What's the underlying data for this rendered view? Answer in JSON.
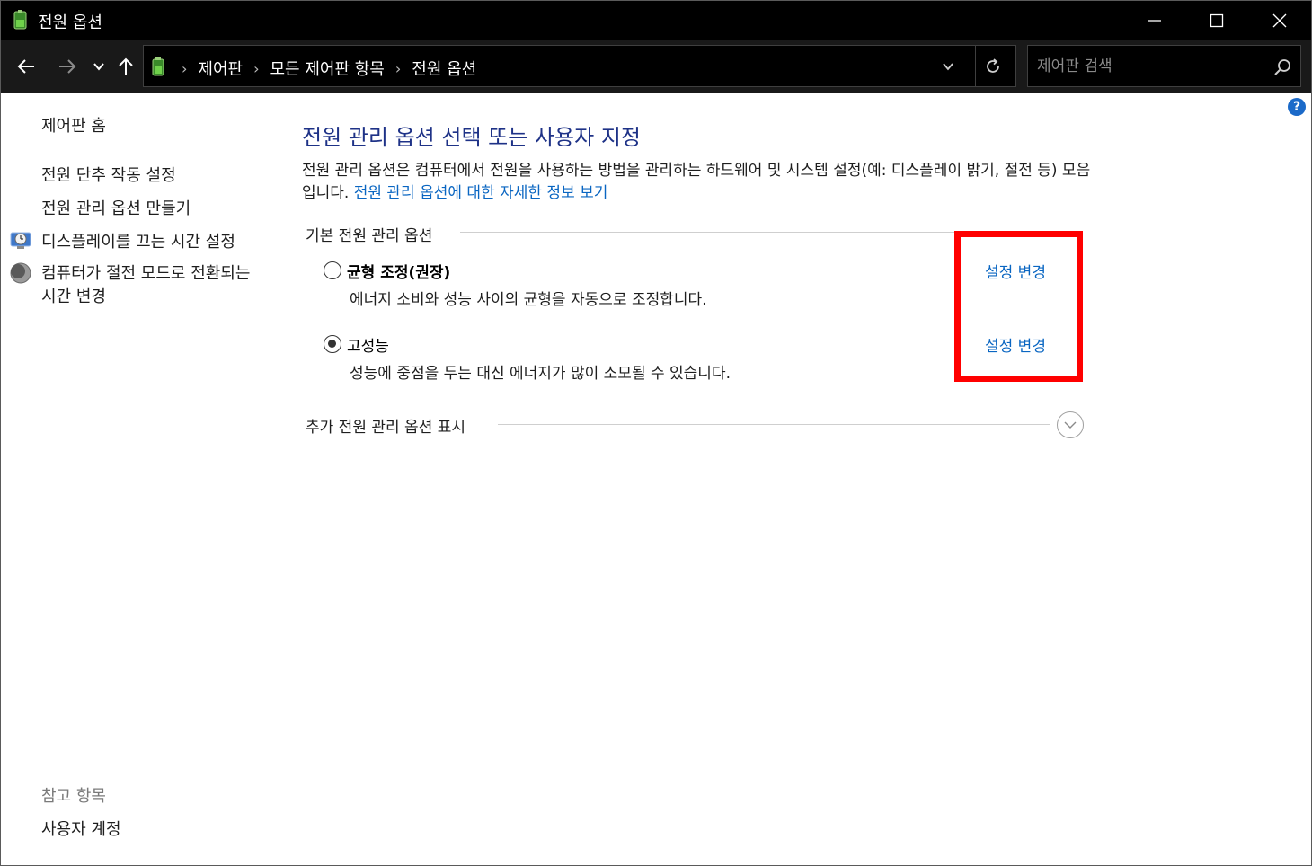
{
  "window": {
    "title": "전원 옵션",
    "icon": "power-options-icon"
  },
  "nav": {
    "breadcrumbs": [
      "제어판",
      "모든 제어판 항목",
      "전원 옵션"
    ],
    "search_placeholder": "제어판 검색"
  },
  "help": {
    "label": "?"
  },
  "sidebar": {
    "home": "제어판 홈",
    "items": [
      {
        "label": "전원 단추 작동 설정",
        "icon": ""
      },
      {
        "label": "전원 관리 옵션 만들기",
        "icon": ""
      },
      {
        "label": "디스플레이를 끄는 시간 설정",
        "icon": "display-clock-icon"
      },
      {
        "label": "컴퓨터가 절전 모드로 전환되는 시간 변경",
        "icon": "moon-icon"
      }
    ],
    "see_also": "참고 항목",
    "see_also_items": [
      "사용자 계정"
    ]
  },
  "main": {
    "title": "전원 관리 옵션 선택 또는 사용자 지정",
    "description": "전원 관리 옵션은 컴퓨터에서 전원을 사용하는 방법을 관리하는 하드웨어 및 시스템 설정(예: 디스플레이 밝기, 절전 등) 모음입니다. ",
    "description_link": "전원 관리 옵션에 대한 자세한 정보 보기",
    "group_label": "기본 전원 관리 옵션",
    "plans": [
      {
        "name": "균형 조정(권장)",
        "description": "에너지 소비와 성능 사이의 균형을 자동으로 조정합니다.",
        "selected": false,
        "link": "설정 변경"
      },
      {
        "name": "고성능",
        "description": "성능에 중점을 두는 대신 에너지가 많이 소모될 수 있습니다.",
        "selected": true,
        "link": "설정 변경"
      }
    ],
    "more_options": "추가 전원 관리 옵션 표시"
  },
  "colors": {
    "title_blue": "#1e3287",
    "link_blue": "#0a66c2",
    "highlight_red": "#ff0000"
  }
}
